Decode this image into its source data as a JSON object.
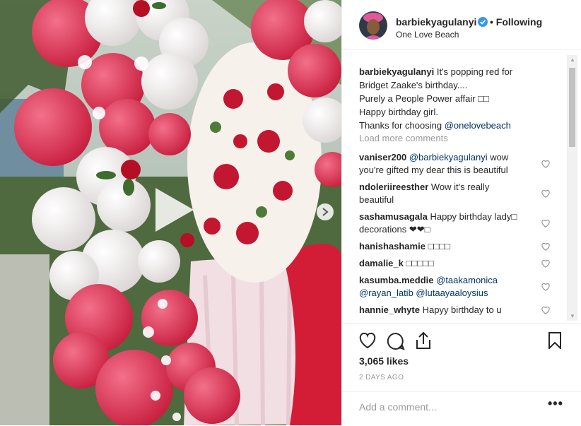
{
  "post": {
    "username": "barbiekyagulanyi",
    "follow_separator": "•",
    "follow_label": "Following",
    "location": "One Love Beach",
    "caption_user": "barbiekyagulanyi",
    "caption_lines": [
      "It's popping red for",
      "Bridget Zaake's birthday....",
      "Purely a People Power affair □□",
      "Happy birthday girl.",
      "Thanks for choosing"
    ],
    "caption_mention": "@onelovebeach",
    "load_more": "Load more comments"
  },
  "comments": [
    {
      "user": "vaniser200",
      "mention": "@barbiekyagulanyi",
      "text1": "wow",
      "text2": "you're gifted my dear this is beautiful"
    },
    {
      "user": "ndoleriireesther",
      "text1": "Wow it's really",
      "text2": "beautiful"
    },
    {
      "user": "sashamusagala",
      "text1": "Happy birthday lady□",
      "text2": "decorations ❤❤□"
    },
    {
      "user": "hanishashamie",
      "text1": "□□□□"
    },
    {
      "user": "damalie_k",
      "text1": "□□□□□"
    },
    {
      "user": "kasumba.meddie",
      "mention": "@taakamonica",
      "line2": "@rayan_latib @lutaayaaloysius"
    },
    {
      "user": "hannie_whyte",
      "text1": "Hapyy birthday to u"
    }
  ],
  "footer": {
    "likes": "3,065 likes",
    "date": "2 DAYS AGO",
    "add_comment_placeholder": "Add a comment...",
    "more": "•••"
  },
  "colors": {
    "text": "#262626",
    "link": "#003569",
    "muted": "#999999",
    "verified": "#3897f0",
    "border": "#efefef"
  },
  "icons": [
    "play-icon",
    "next-arrow-icon",
    "verified-badge-icon",
    "heart-icon",
    "comment-icon",
    "share-icon",
    "bookmark-icon",
    "more-icon"
  ]
}
